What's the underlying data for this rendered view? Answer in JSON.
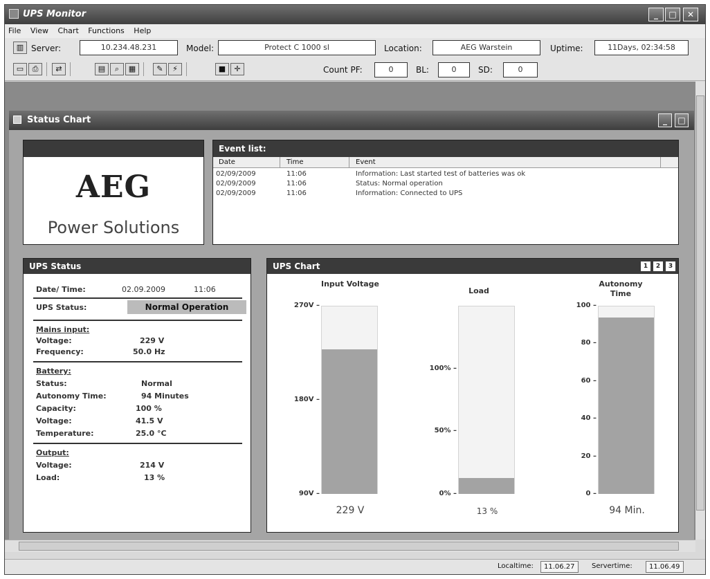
{
  "window": {
    "title": "UPS Monitor"
  },
  "menu": [
    "File",
    "View",
    "Chart",
    "Functions",
    "Help"
  ],
  "connection": {
    "server_label": "Server:",
    "server": "10.234.48.231",
    "model_label": "Model:",
    "model": "Protect C 1000 sl",
    "location_label": "Location:",
    "location": "AEG Warstein",
    "uptime_label": "Uptime:",
    "uptime": "11Days, 02:34:58"
  },
  "counters": {
    "label_pf": "Count PF:",
    "pf": "0",
    "label_bl": "BL:",
    "bl": "0",
    "label_sd": "SD:",
    "sd": "0"
  },
  "child": {
    "title": "Status Chart"
  },
  "logo": {
    "brand": "AEG",
    "tagline": "Power Solutions"
  },
  "events": {
    "title": "Event list:",
    "columns": [
      "Date",
      "Time",
      "Event"
    ],
    "rows": [
      {
        "date": "02/09/2009",
        "time": "11:06",
        "event": "Information: Last started test of batteries was ok"
      },
      {
        "date": "02/09/2009",
        "time": "11:06",
        "event": "Status: Normal operation"
      },
      {
        "date": "02/09/2009",
        "time": "11:06",
        "event": "Information: Connected to UPS"
      }
    ]
  },
  "status": {
    "title": "UPS Status",
    "datetime_label": "Date/ Time:",
    "date": "02.09.2009",
    "time": "11:06",
    "status_label": "UPS Status:",
    "status_value": "Normal Operation",
    "mains": {
      "heading": "Mains input:",
      "voltage_label": "Voltage:",
      "voltage": "229 V",
      "frequency_label": "Frequency:",
      "frequency": "50.0 Hz"
    },
    "battery": {
      "heading": "Battery:",
      "status_label": "Status:",
      "status": "Normal",
      "autonomy_label": "Autonomy Time:",
      "autonomy": "94 Minutes",
      "capacity_label": "Capacity:",
      "capacity": "100 %",
      "voltage_label": "Voltage:",
      "voltage": "41.5 V",
      "temperature_label": "Temperature:",
      "temperature": "25.0 °C"
    },
    "output": {
      "heading": "Output:",
      "voltage_label": "Voltage:",
      "voltage": "214 V",
      "load_label": "Load:",
      "load": "13 %"
    }
  },
  "ups_chart": {
    "title": "UPS Chart",
    "buttons": [
      "1",
      "2",
      "3"
    ],
    "gauges": [
      {
        "title": "Input Voltage",
        "min": 90,
        "max": 270,
        "value": 229,
        "value_label": "229 V",
        "tick_labels": [
          "270V",
          "180V",
          "90V"
        ]
      },
      {
        "title": "Load",
        "min": 0,
        "max": 150,
        "value": 13,
        "value_label": "13 %",
        "tick_labels": [
          "100%",
          "50%",
          "0%"
        ]
      },
      {
        "title": "Autonomy Time",
        "min": 0,
        "max": 100,
        "value": 94,
        "value_label": "94 Min.",
        "tick_labels": [
          "100",
          "80",
          "60",
          "40",
          "20",
          "0"
        ]
      }
    ]
  },
  "statusbar": {
    "localtime_label": "Localtime:",
    "localtime": "11.06.27",
    "servertime_label": "Servertime:",
    "servertime": "11.06.49"
  },
  "colors": {
    "title_bar": "#3f3f3f",
    "panel_header": "#3a3a3a",
    "bar_fill": "#a3a3a3"
  }
}
